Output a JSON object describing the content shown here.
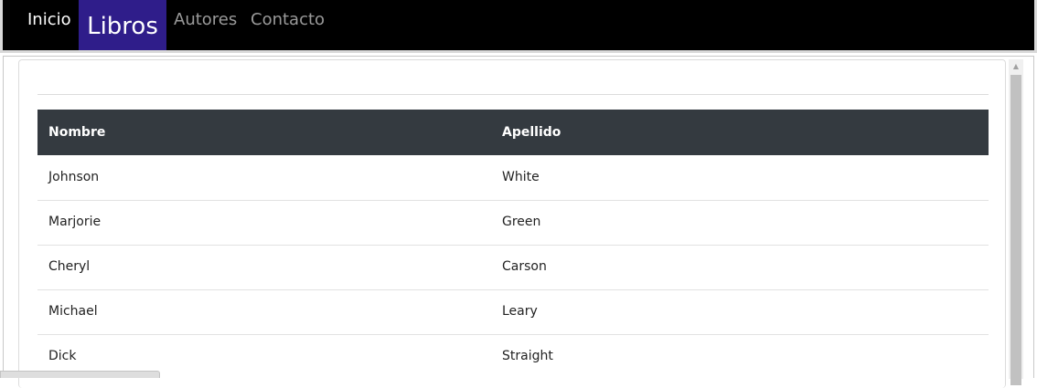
{
  "nav": {
    "items": [
      {
        "label": "Inicio"
      },
      {
        "label": "Libros"
      },
      {
        "label": "Autores"
      },
      {
        "label": "Contacto"
      }
    ],
    "active_item": "Libros"
  },
  "table": {
    "headers": [
      "Nombre",
      "Apellido"
    ],
    "rows": [
      [
        "Johnson",
        "White"
      ],
      [
        "Marjorie",
        "Green"
      ],
      [
        "Cheryl",
        "Carson"
      ],
      [
        "Michael",
        "Leary"
      ],
      [
        "Dick",
        "Straight"
      ]
    ]
  },
  "colors": {
    "navbar_bg": "#000000",
    "active_nav_bg": "#2f1d8a",
    "table_header_bg": "#343a40"
  },
  "icons": {
    "scroll_up": "scroll-up-arrow-icon"
  }
}
